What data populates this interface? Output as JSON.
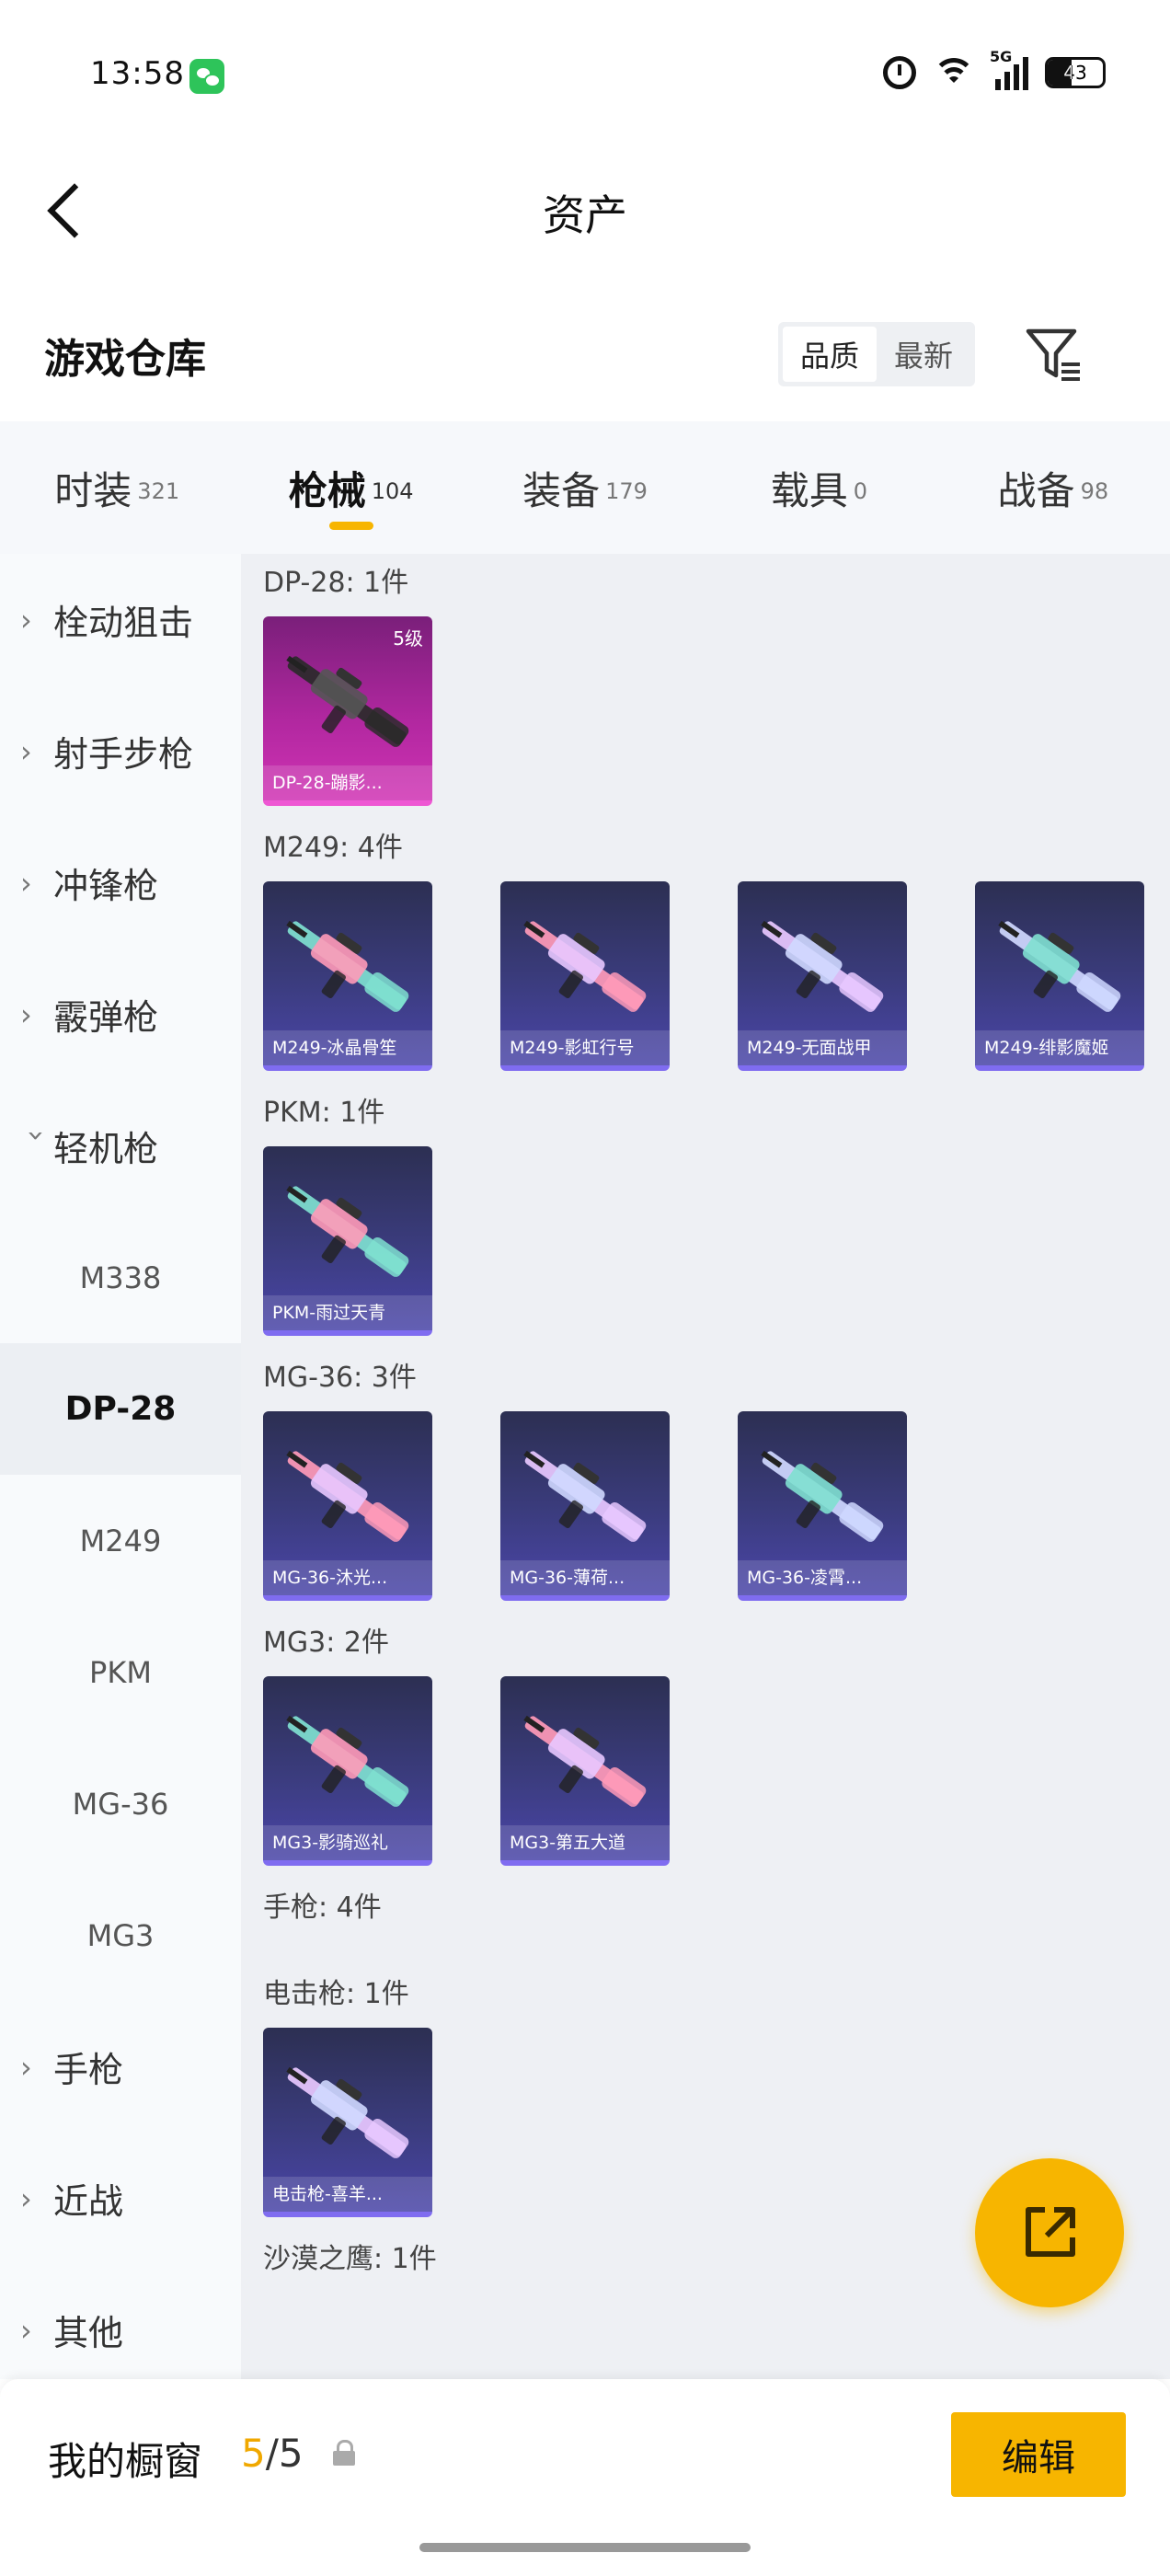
{
  "status_bar": {
    "time": "13:58",
    "network": "5G",
    "battery": "43"
  },
  "header": {
    "title": "资产"
  },
  "warehouse": {
    "title": "游戏仓库",
    "sort_options": [
      "品质",
      "最新"
    ],
    "active_sort": "品质"
  },
  "category_tabs": [
    {
      "label": "时装",
      "count": "321"
    },
    {
      "label": "枪械",
      "count": "104",
      "active": true
    },
    {
      "label": "装备",
      "count": "179"
    },
    {
      "label": "载具",
      "count": "0"
    },
    {
      "label": "战备",
      "count": "98"
    }
  ],
  "sidebar": {
    "items": [
      {
        "label": "栓动狙击",
        "type": "group",
        "expanded": false
      },
      {
        "label": "射手步枪",
        "type": "group",
        "expanded": false
      },
      {
        "label": "冲锋枪",
        "type": "group",
        "expanded": false
      },
      {
        "label": "霰弹枪",
        "type": "group",
        "expanded": false
      },
      {
        "label": "轻机枪",
        "type": "group",
        "expanded": true
      },
      {
        "label": "M338",
        "type": "sub"
      },
      {
        "label": "DP-28",
        "type": "sub",
        "selected": true
      },
      {
        "label": "M249",
        "type": "sub"
      },
      {
        "label": "PKM",
        "type": "sub"
      },
      {
        "label": "MG-36",
        "type": "sub"
      },
      {
        "label": "MG3",
        "type": "sub"
      },
      {
        "label": "手枪",
        "type": "group",
        "expanded": false
      },
      {
        "label": "近战",
        "type": "group",
        "expanded": false
      },
      {
        "label": "其他",
        "type": "group",
        "expanded": false
      }
    ]
  },
  "sections": [
    {
      "label": "DP-28: 1件",
      "items": [
        {
          "name": "DP-28-蹦影...",
          "grade": "5级",
          "rarity": "pink"
        }
      ]
    },
    {
      "label": "M249: 4件",
      "items": [
        {
          "name": "M249-冰晶骨笙",
          "rarity": "purple"
        },
        {
          "name": "M249-影虹行号",
          "rarity": "purple"
        },
        {
          "name": "M249-无面战甲",
          "rarity": "purple"
        },
        {
          "name": "M249-绯影魔姬",
          "rarity": "purple"
        }
      ]
    },
    {
      "label": "PKM: 1件",
      "items": [
        {
          "name": "PKM-雨过天青",
          "rarity": "purple"
        }
      ]
    },
    {
      "label": "MG-36: 3件",
      "items": [
        {
          "name": "MG-36-沐光...",
          "rarity": "purple"
        },
        {
          "name": "MG-36-薄荷...",
          "rarity": "purple"
        },
        {
          "name": "MG-36-凌霄...",
          "rarity": "purple"
        }
      ]
    },
    {
      "label": "MG3: 2件",
      "items": [
        {
          "name": "MG3-影骑巡礼",
          "rarity": "purple"
        },
        {
          "name": "MG3-第五大道",
          "rarity": "purple"
        }
      ]
    },
    {
      "label": "手枪: 4件",
      "items": []
    },
    {
      "label": "电击枪: 1件",
      "items": [
        {
          "name": "电击枪-喜羊...",
          "rarity": "purple"
        }
      ]
    },
    {
      "label": "沙漠之鹰: 1件",
      "items": []
    }
  ],
  "bottom_bar": {
    "showcase_label": "我的橱窗",
    "showcase_current": "5",
    "showcase_total": "/5",
    "edit_label": "编辑"
  },
  "icons": {
    "back": "chevron-left-icon",
    "filter": "filter-icon",
    "fab": "share-external-icon",
    "lock": "lock-icon"
  },
  "colors": {
    "accent": "#f7b500",
    "legendary": "#d033b4",
    "epic": "#4a45a8"
  }
}
